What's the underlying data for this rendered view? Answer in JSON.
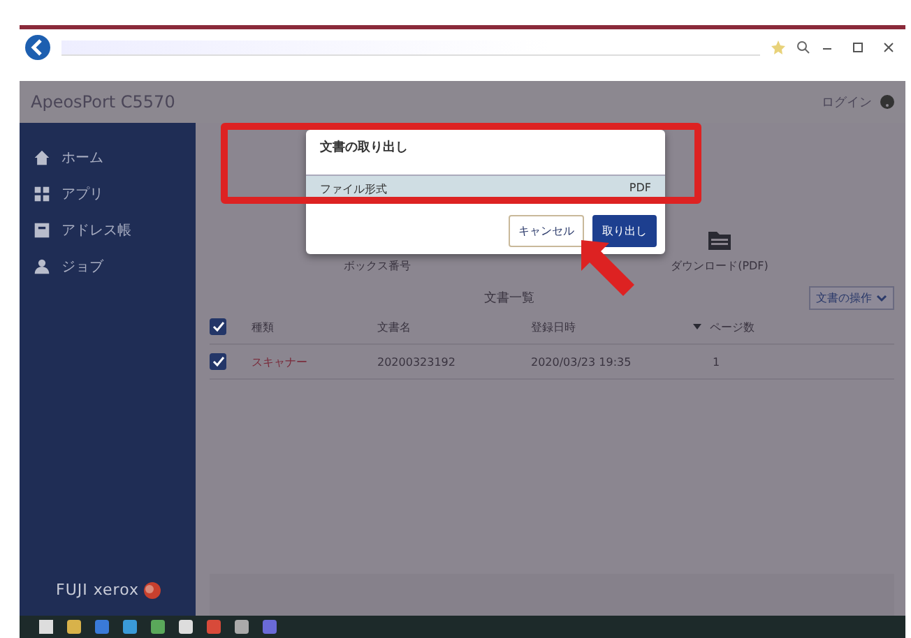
{
  "app": {
    "title": "ApeosPort C5570",
    "login": "ログイン"
  },
  "sidebar": {
    "items": [
      {
        "label": "ホーム"
      },
      {
        "label": "アプリ"
      },
      {
        "label": "アドレス帳"
      },
      {
        "label": "ジョブ"
      }
    ],
    "logo": "FUJI xerox"
  },
  "main": {
    "box_label": "ボックス番号",
    "download_label": "ダウンロード(PDF)",
    "list_title": "文書一覧",
    "operations": "文書の操作"
  },
  "table": {
    "header_checked": true,
    "columns": [
      "種類",
      "文書名",
      "登録日時",
      "ページ数"
    ],
    "rows": [
      {
        "checked": true,
        "cells": [
          "スキャナー",
          "20200323192",
          "2020/03/23 19:35",
          "1"
        ]
      }
    ]
  },
  "dialog": {
    "title": "文書の取り出し",
    "field": {
      "label": "ファイル形式",
      "value": "PDF"
    },
    "buttons": [
      {
        "label": "キャンセル",
        "kind": "secondary"
      },
      {
        "label": "取り出し",
        "kind": "primary"
      }
    ]
  }
}
